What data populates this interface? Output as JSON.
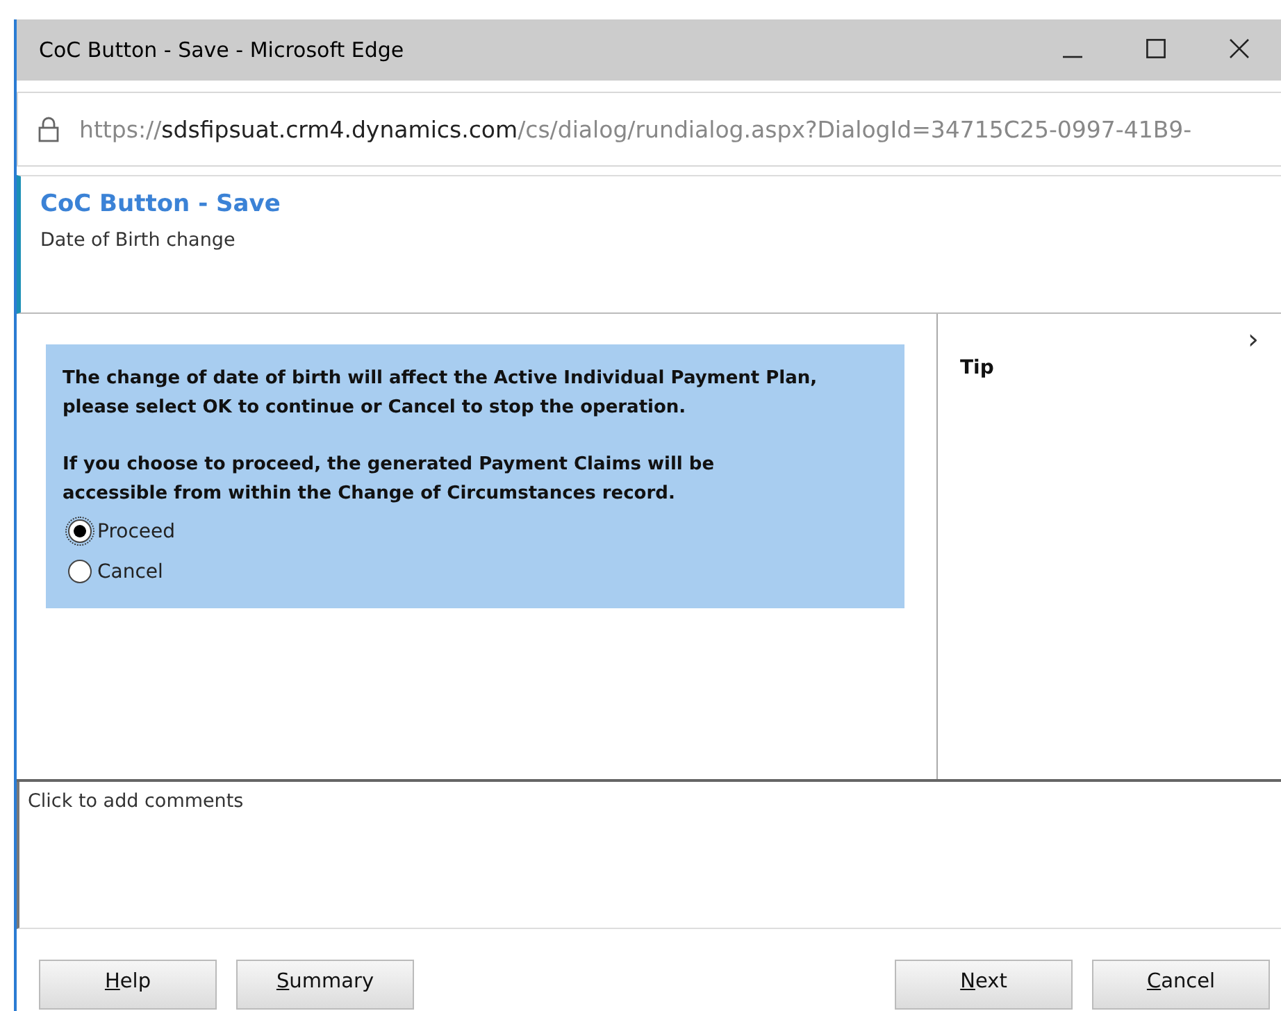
{
  "window": {
    "title": "CoC Button - Save - Microsoft Edge",
    "controls": [
      {
        "kind": "minimize"
      },
      {
        "kind": "maximize"
      },
      {
        "kind": "close"
      }
    ]
  },
  "address_bar": {
    "scheme": "https://",
    "host": "sdsfipsuat.crm4.dynamics.com",
    "path": "/cs/dialog/rundialog.aspx?DialogId=34715C25-0997-41B9-"
  },
  "header": {
    "title": "CoC Button - Save",
    "subtitle": "Date of Birth change"
  },
  "prompt": {
    "paragraphs": [
      {
        "lines": [
          "The change of date of birth will affect the Active Individual Payment Plan,",
          "please select OK to continue or Cancel to stop the operation."
        ]
      },
      {
        "lines": [
          "If you choose to proceed, the generated Payment Claims will be",
          "accessible from within the Change of Circumstances record."
        ]
      }
    ],
    "options": [
      {
        "label": "Proceed",
        "selected": true
      },
      {
        "label": "Cancel",
        "selected": false
      }
    ]
  },
  "tip_panel": {
    "title": "Tip",
    "toggle": "›"
  },
  "comments": {
    "placeholder": "Click to add comments"
  },
  "left_buttons": [
    {
      "access_key": "H",
      "rest": "elp"
    },
    {
      "access_key": "S",
      "rest": "ummary"
    }
  ],
  "right_buttons": [
    {
      "access_key": "N",
      "rest": "ext"
    },
    {
      "access_key": "C",
      "rest": "ancel"
    }
  ]
}
